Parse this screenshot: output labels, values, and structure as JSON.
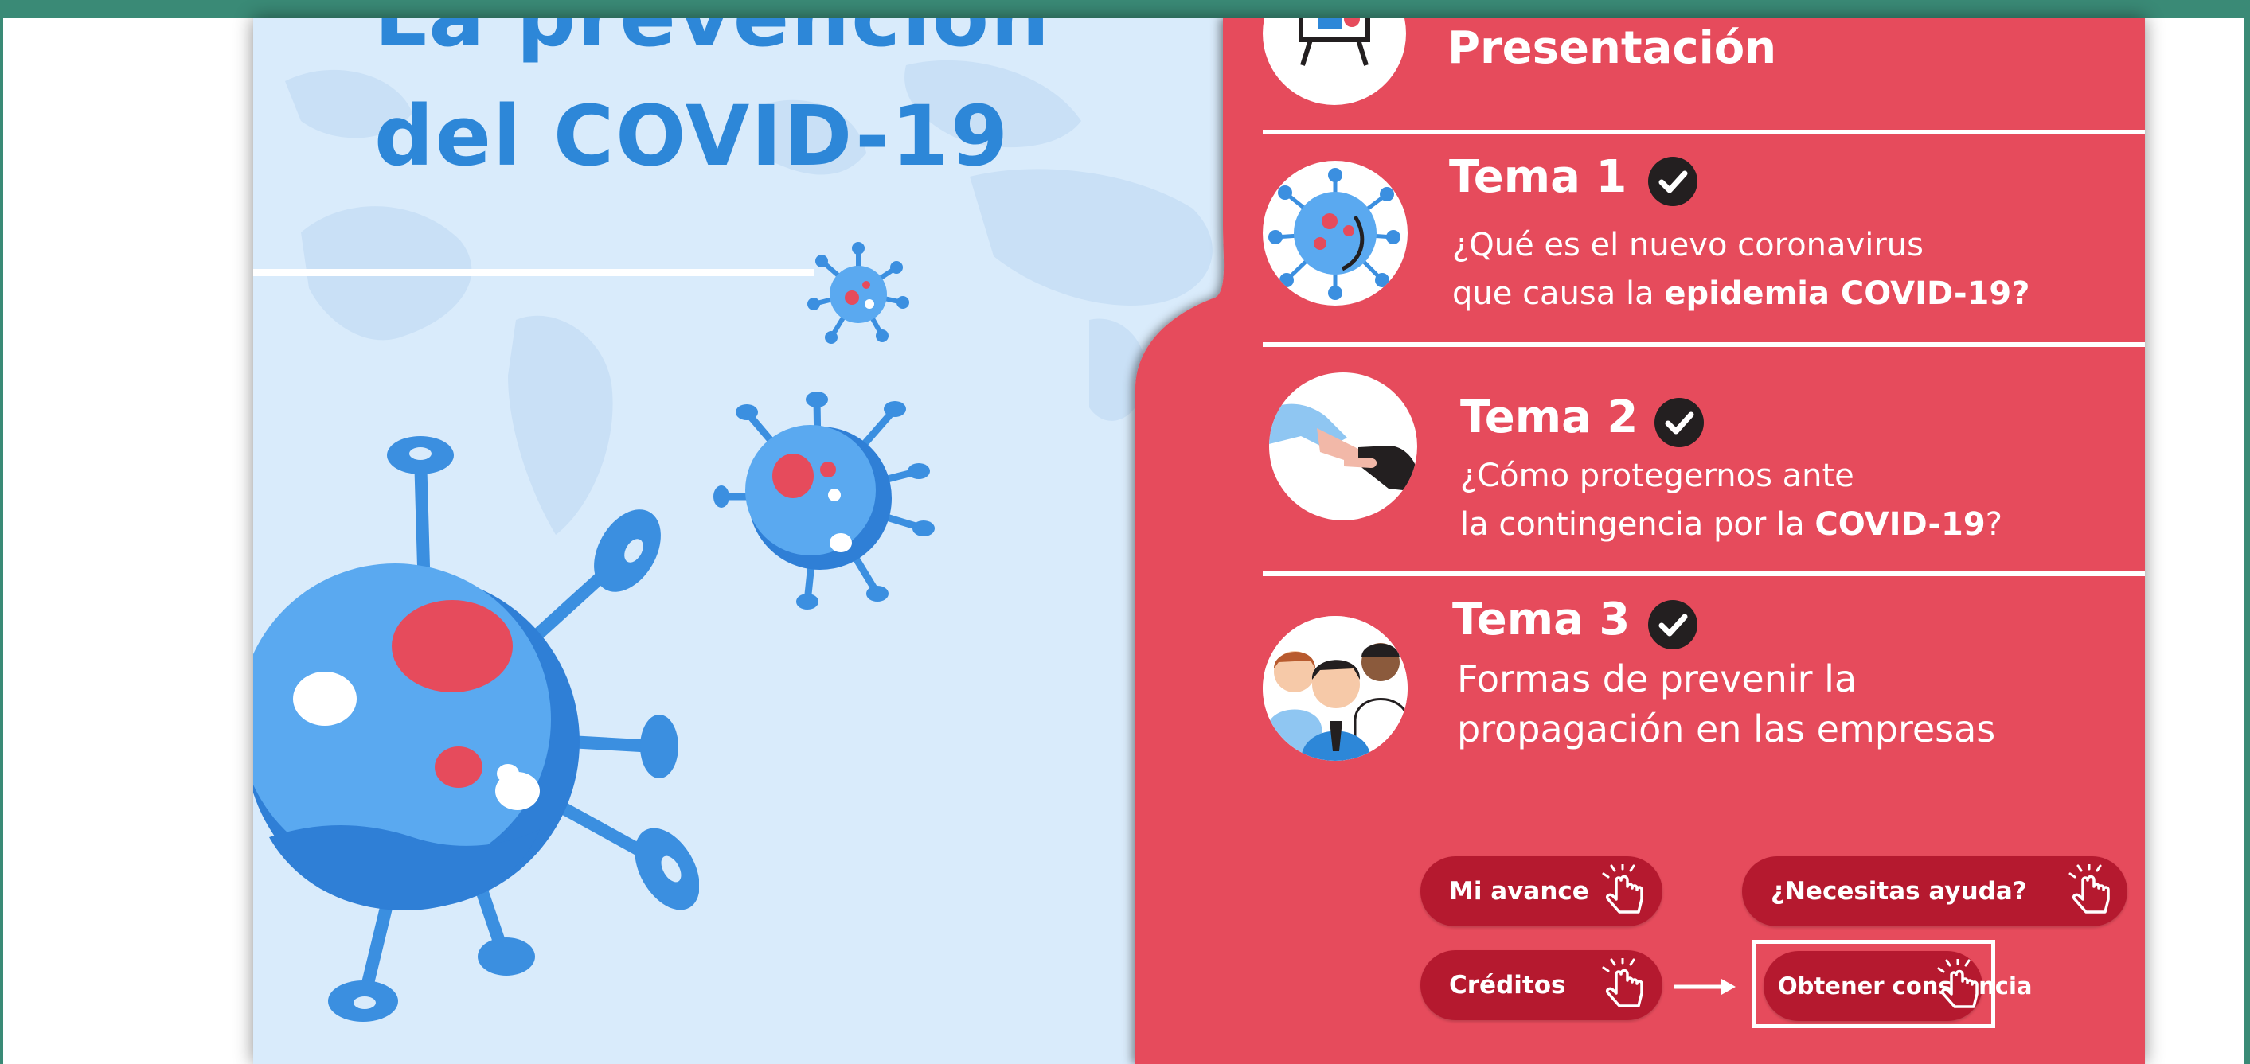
{
  "course": {
    "title_line1": "La prevención",
    "title_line2": "del COVID-19"
  },
  "menu": {
    "presentation_label": "Presentación",
    "topics": [
      {
        "title": "Tema 1",
        "completed": true,
        "desc_line1": "¿Qué es el nuevo coronavirus",
        "desc_line2_plain": "que causa la ",
        "desc_line2_bold": "epidemia COVID-19?"
      },
      {
        "title": "Tema 2",
        "completed": true,
        "desc_line1": "¿Cómo protegernos ante",
        "desc_line2_plain": "la contingencia por la ",
        "desc_line2_bold": "COVID-19",
        "desc_line2_end": "?"
      },
      {
        "title": "Tema 3",
        "completed": true,
        "desc_line1": "Formas de prevenir la",
        "desc_line2": "propagación en las empresas"
      }
    ]
  },
  "buttons": {
    "progress": "Mi avance",
    "help": "¿Necesitas ayuda?",
    "credits": "Créditos",
    "certificate": "Obtener constancia"
  },
  "colors": {
    "panel_red": "#e64b5c",
    "button_red": "#b5192f",
    "title_blue": "#2d87d8",
    "panel_blue": "#d9ebfb",
    "frame_green": "#3a8a76"
  },
  "icons": {
    "presentation": "presentation-board-icon",
    "topic1": "virus-icon",
    "topic2": "handshake-icon",
    "topic3": "people-icon",
    "check": "check-icon",
    "hand": "hand-pointer-icon",
    "arrow": "arrow-right-icon"
  }
}
